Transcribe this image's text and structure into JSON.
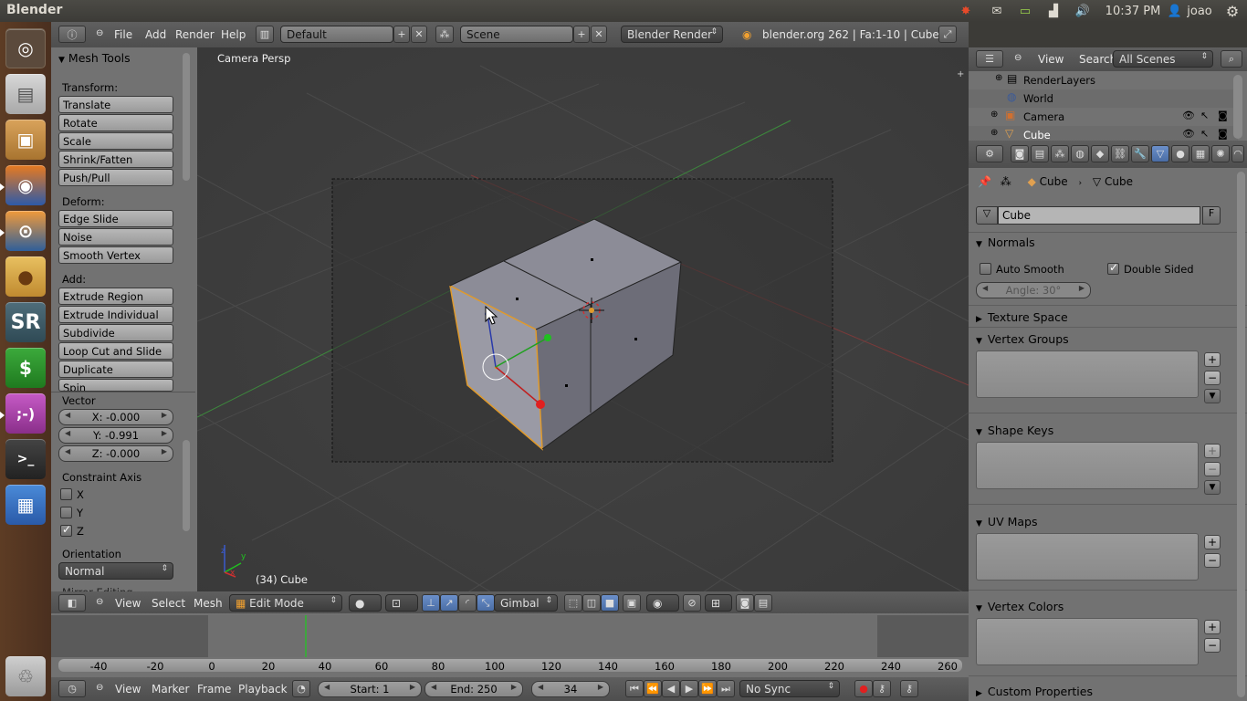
{
  "topbar": {
    "app_title": "Blender",
    "clock": "10:37 PM",
    "user": "joao"
  },
  "launcher": {
    "items": [
      "dash-icon",
      "files-icon",
      "archive-icon",
      "firefox-icon",
      "blender-icon",
      "cookie-icon",
      "sr-icon",
      "money-icon",
      "chat-icon",
      "terminal-icon",
      "workspace-icon",
      "trash-icon"
    ]
  },
  "info_header": {
    "menus": [
      "File",
      "Add",
      "Render",
      "Help"
    ],
    "layout": "Default",
    "scene": "Scene",
    "engine": "Blender Render",
    "stats": "blender.org 262 | Fa:1-10 | Cube"
  },
  "toolshelf": {
    "title": "Mesh Tools",
    "transform_label": "Transform:",
    "transform": [
      "Translate",
      "Rotate",
      "Scale",
      "Shrink/Fatten",
      "Push/Pull"
    ],
    "deform_label": "Deform:",
    "deform": [
      "Edge Slide",
      "Noise",
      "Smooth Vertex"
    ],
    "add_label": "Add:",
    "add": [
      "Extrude Region",
      "Extrude Individual",
      "Subdivide",
      "Loop Cut and Slide",
      "Duplicate",
      "Spin"
    ],
    "vector_label": "Vector",
    "x": "X: -0.000",
    "y": "Y: -0.991",
    "z": "Z: -0.000",
    "constraint_label": "Constraint Axis",
    "cx": "X",
    "cy": "Y",
    "cz": "Z",
    "cz_checked": true,
    "orientation_label": "Orientation",
    "orientation": "Normal",
    "mirror_label": "Mirror Editing"
  },
  "viewport": {
    "view_name": "Camera Persp",
    "object_label": "(34) Cube"
  },
  "view3d_header": {
    "menus": [
      "View",
      "Select",
      "Mesh"
    ],
    "mode": "Edit Mode",
    "orientation": "Gimbal"
  },
  "timeline": {
    "ruler": [
      "-40",
      "-20",
      "0",
      "20",
      "40",
      "60",
      "80",
      "100",
      "120",
      "140",
      "160",
      "180",
      "200",
      "220",
      "240",
      "260"
    ],
    "current_frame_pct": 0.2,
    "menus": [
      "View",
      "Marker",
      "Frame",
      "Playback"
    ],
    "start": "Start: 1",
    "end": "End: 250",
    "current": "34",
    "sync": "No Sync"
  },
  "outliner": {
    "menus": [
      "View",
      "Search"
    ],
    "filter": "All Scenes",
    "items": [
      "RenderLayers",
      "World",
      "Camera",
      "Cube"
    ]
  },
  "properties": {
    "breadcrumb_obj": "Cube",
    "breadcrumb_mesh": "Cube",
    "mesh_name": "Cube",
    "fake_user": "F",
    "normals": "Normals",
    "auto_smooth": "Auto Smooth",
    "double_sided": "Double Sided",
    "angle": "Angle: 30°",
    "texture_space": "Texture Space",
    "vertex_groups": "Vertex Groups",
    "shape_keys": "Shape Keys",
    "uv_maps": "UV Maps",
    "vertex_colors": "Vertex Colors",
    "custom_properties": "Custom Properties"
  },
  "colors": {
    "accent": "#5680c2",
    "selected_edge": "#e09a2b",
    "grid": "#4a4a4a"
  }
}
